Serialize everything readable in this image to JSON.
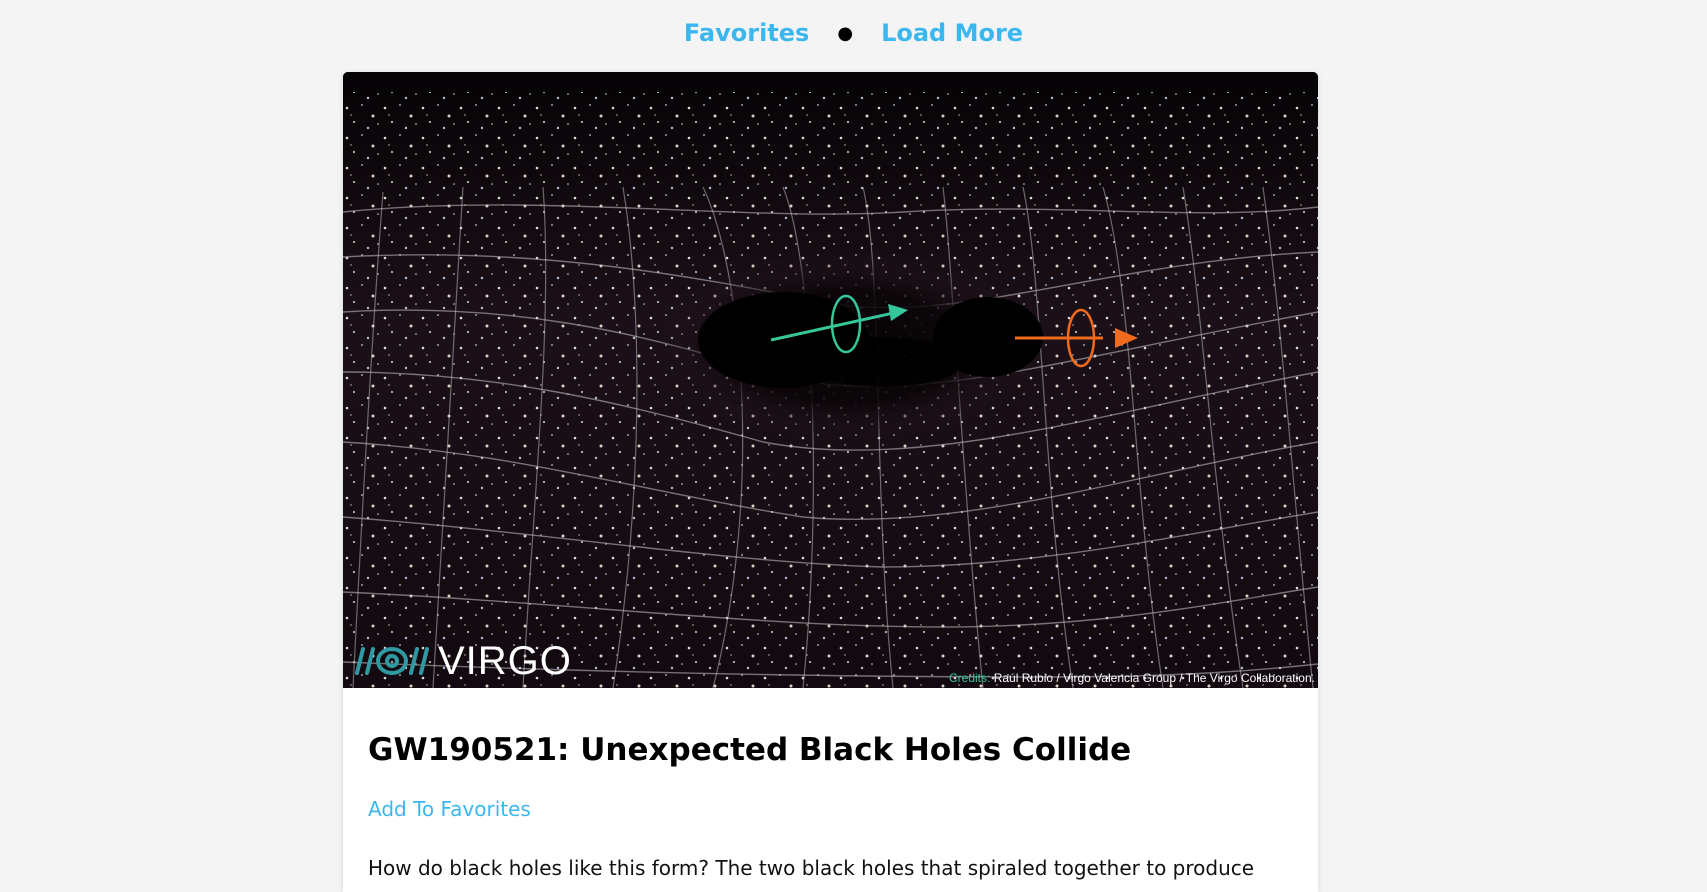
{
  "nav": {
    "favorites": "Favorites",
    "separator": "●",
    "load_more": "Load More"
  },
  "post": {
    "image": {
      "alt": "Two black holes warping space-time grid with spin arrows",
      "logo_text": "VIRGO",
      "credit_label": "Credits:",
      "credit_text": "Raúl Rubio / Virgo Valencia Group / The Virgo Collaboration."
    },
    "title": "GW190521: Unexpected Black Holes Collide",
    "add_to_favorites": "Add To Favorites",
    "description": "How do black holes like this form? The two black holes that spiraled together to produce"
  },
  "colors": {
    "link": "#3bb7f0",
    "page_bg": "#f4f4f4",
    "arrow_green": "#35c79a",
    "arrow_orange": "#f26b1d"
  }
}
